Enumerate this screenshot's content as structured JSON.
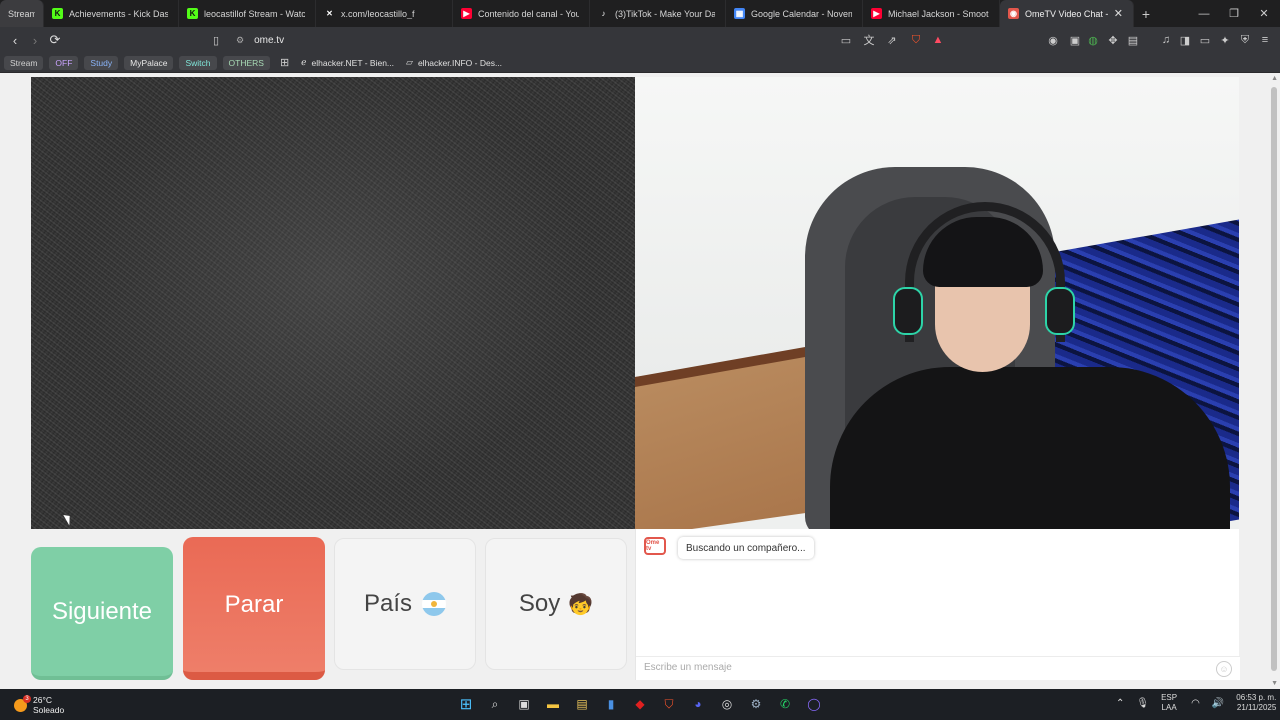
{
  "browser": {
    "tabs": [
      {
        "title": "Stream",
        "favicon": "none",
        "color": "#3c3c3f"
      },
      {
        "title": "Achievements - Kick Dashboard",
        "favicon": "kick-icon",
        "color": "#53fc18"
      },
      {
        "title": "leocastillof Stream - Watch Live",
        "favicon": "kick-icon",
        "color": "#53fc18"
      },
      {
        "title": "x.com/leocastillo_f",
        "favicon": "x-icon",
        "color": "#ffffff"
      },
      {
        "title": "Contenido del canal - YouTube Studio",
        "favicon": "youtube-icon",
        "color": "#ff0033"
      },
      {
        "title": "(3)TikTok - Make Your Day",
        "favicon": "tiktok-icon",
        "color": "#ffffff"
      },
      {
        "title": "Google Calendar - November",
        "favicon": "calendar-icon",
        "color": "#4285f4"
      },
      {
        "title": "Michael Jackson - Smooth Criminal",
        "favicon": "youtube-icon",
        "color": "#ff0033"
      },
      {
        "title": "OmeTV Video Chat - ",
        "favicon": "ometv-icon",
        "color": "#e2574c"
      }
    ],
    "address": "ome.tv",
    "bookmarks": {
      "chips": [
        {
          "label": "Stream",
          "color": "#c0c0c0"
        },
        {
          "label": "OFF",
          "color": "#c9a3ff"
        },
        {
          "label": "Study",
          "color": "#8ab4f8"
        },
        {
          "label": "MyPalace",
          "color": "#e8e8e8"
        },
        {
          "label": "Switch",
          "color": "#81e6d9"
        },
        {
          "label": "OTHERS",
          "color": "#a8dab5"
        }
      ],
      "links": [
        {
          "label": "elhacker.NET - Bien..."
        },
        {
          "label": "elhacker.INFO - Des..."
        }
      ]
    }
  },
  "controls": {
    "next_label": "Siguiente",
    "stop_label": "Parar",
    "country_label": "País",
    "me_label": "Soy",
    "me_emoji": "🧒"
  },
  "chat": {
    "logo_text": "Ome tv",
    "status": "Buscando un compañero...",
    "input_placeholder": "Escribe un mensaje"
  },
  "taskbar": {
    "weather_temp": "26°C",
    "weather_desc": "Soleado",
    "weather_badge": "3",
    "lang_top": "ESP",
    "lang_bottom": "LAA",
    "time": "06:53 p. m.",
    "date": "21/11/2025"
  }
}
